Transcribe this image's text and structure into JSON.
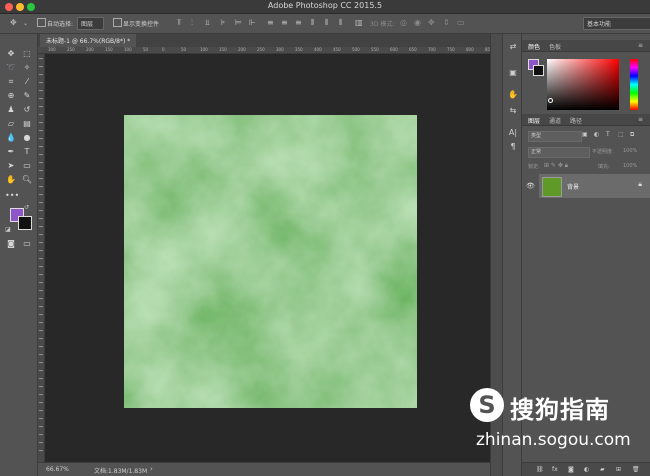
{
  "app": {
    "title": "Adobe Photoshop CC 2015.5"
  },
  "options_bar": {
    "auto_select_label": "自动选择:",
    "auto_select_value": "图层",
    "show_transform_label": "显示变换控件",
    "mode_3d_label": "3D 模式:",
    "workspace_value": "基本功能"
  },
  "document": {
    "tab_title": "未标题-1 @ 66.7%(RGB/8*) *",
    "canvas_fill": "green clouds texture",
    "canvas_color": "#5f9a28"
  },
  "ruler": {
    "top_ticks": [
      "300",
      "250",
      "200",
      "150",
      "100",
      "50",
      "0",
      "50",
      "100",
      "150",
      "200",
      "250",
      "300",
      "350",
      "400",
      "450",
      "500",
      "550",
      "600",
      "650",
      "700",
      "750",
      "800",
      "850"
    ]
  },
  "status": {
    "zoom": "66.67%",
    "doc_size": "文档:1.83M/1.83M"
  },
  "color_panel": {
    "tabs": [
      "颜色",
      "色板"
    ],
    "foreground_color": "#8e55c8",
    "background_color": "#111111"
  },
  "layers_panel": {
    "tabs": [
      "图层",
      "通道",
      "路径"
    ],
    "filter_kind": "类型",
    "blend_mode": "正常",
    "opacity_label": "不透明度:",
    "opacity_value": "100%",
    "lock_label": "锁定:",
    "fill_label": "填充:",
    "fill_value": "100%",
    "layers": [
      {
        "name": "背景",
        "locked": true,
        "visible": true
      }
    ]
  },
  "watermark": {
    "brand": "搜狗指南",
    "url": "zhinan.sogou.com"
  }
}
